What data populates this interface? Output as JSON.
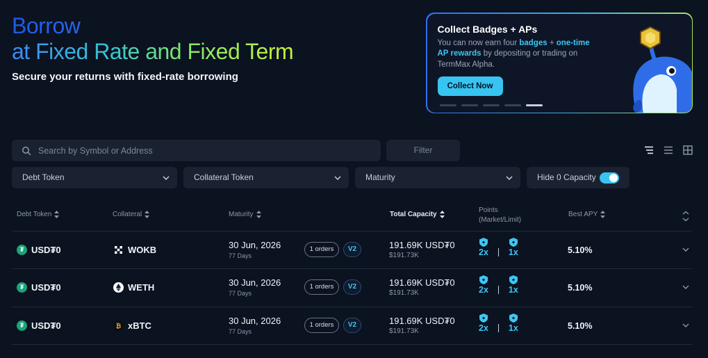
{
  "hero": {
    "title_line1": "Borrow",
    "title_line2": "at Fixed Rate and Fixed Term",
    "subtitle": "Secure your returns with fixed-rate borrowing"
  },
  "promo": {
    "title": "Collect Badges + APs",
    "text_1": "You can now earn four ",
    "text_badges": "badges",
    "text_2": " + ",
    "text_ap": "one-time AP rewards",
    "text_3": " by depositing or trading on TermMax Alpha.",
    "button_label": "Collect Now",
    "slide_count": 5,
    "active_slide": 4
  },
  "toolbar": {
    "search_placeholder": "Search by Symbol or Address",
    "filter_label": "Filter"
  },
  "filters": {
    "debt_token": "Debt Token",
    "collateral_token": "Collateral Token",
    "maturity": "Maturity",
    "hide_zero_label": "Hide 0 Capacity",
    "hide_zero_on": true
  },
  "table": {
    "headers": {
      "debt_token": "Debt Token",
      "collateral": "Collateral",
      "maturity": "Maturity",
      "total_capacity": "Total Capacity",
      "points_line1": "Points",
      "points_line2": "(Market/Limit)",
      "best_apy": "Best APY"
    },
    "rows": [
      {
        "debt": "USD₮0",
        "collateral": "WOKB",
        "maturity": "30 Jun, 2026",
        "days": "77 Days",
        "orders": "1 orders",
        "version": "V2",
        "capacity": "191.69K USD₮0",
        "capacity_usd": "$191.73K",
        "market_mult": "2x",
        "limit_mult": "1x",
        "apy": "5.10%"
      },
      {
        "debt": "USD₮0",
        "collateral": "WETH",
        "maturity": "30 Jun, 2026",
        "days": "77 Days",
        "orders": "1 orders",
        "version": "V2",
        "capacity": "191.69K USD₮0",
        "capacity_usd": "$191.73K",
        "market_mult": "2x",
        "limit_mult": "1x",
        "apy": "5.10%"
      },
      {
        "debt": "USD₮0",
        "collateral": "xBTC",
        "maturity": "30 Jun, 2026",
        "days": "77 Days",
        "orders": "1 orders",
        "version": "V2",
        "capacity": "191.69K USD₮0",
        "capacity_usd": "$191.73K",
        "market_mult": "2x",
        "limit_mult": "1x",
        "apy": "5.10%"
      }
    ]
  },
  "colors": {
    "accent": "#38c4f0",
    "background": "#0b1220",
    "panel": "#1a2231"
  }
}
